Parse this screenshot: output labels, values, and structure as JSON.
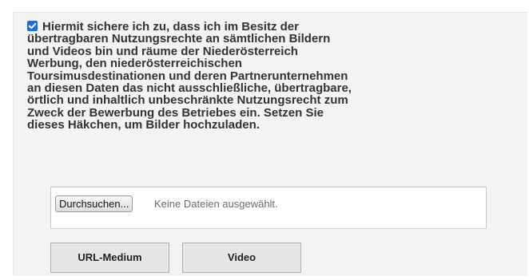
{
  "consent": {
    "checked": true,
    "lines": [
      "Hiermit sichere ich zu, dass ich im Besitz der",
      "übertragbaren Nutzungsrechte an sämtlichen Bildern",
      "und Videos bin und räume der Niederösterreich",
      "Werbung, den niederösterreichischen",
      "Toursimusdestinationen und deren Partnerunternehmen",
      "an diesen Daten das nicht ausschließliche, übertragbare,",
      "örtlich und inhaltlich unbeschränkte Nutzungsrecht zum",
      "Zweck der Bewerbung des Betriebes ein. Setzen Sie",
      "dieses Häkchen, um Bilder hochzuladen."
    ]
  },
  "upload": {
    "browse_label": "Durchsuchen...",
    "status_text": "Keine Dateien ausgewählt."
  },
  "buttons": {
    "url_medium_label": "URL-Medium",
    "video_label": "Video"
  },
  "colors": {
    "checkbox_accent": "#1e6fd9",
    "panel_background": "#f3f3f3"
  },
  "icons": {
    "checkbox": "checkmark-icon"
  }
}
